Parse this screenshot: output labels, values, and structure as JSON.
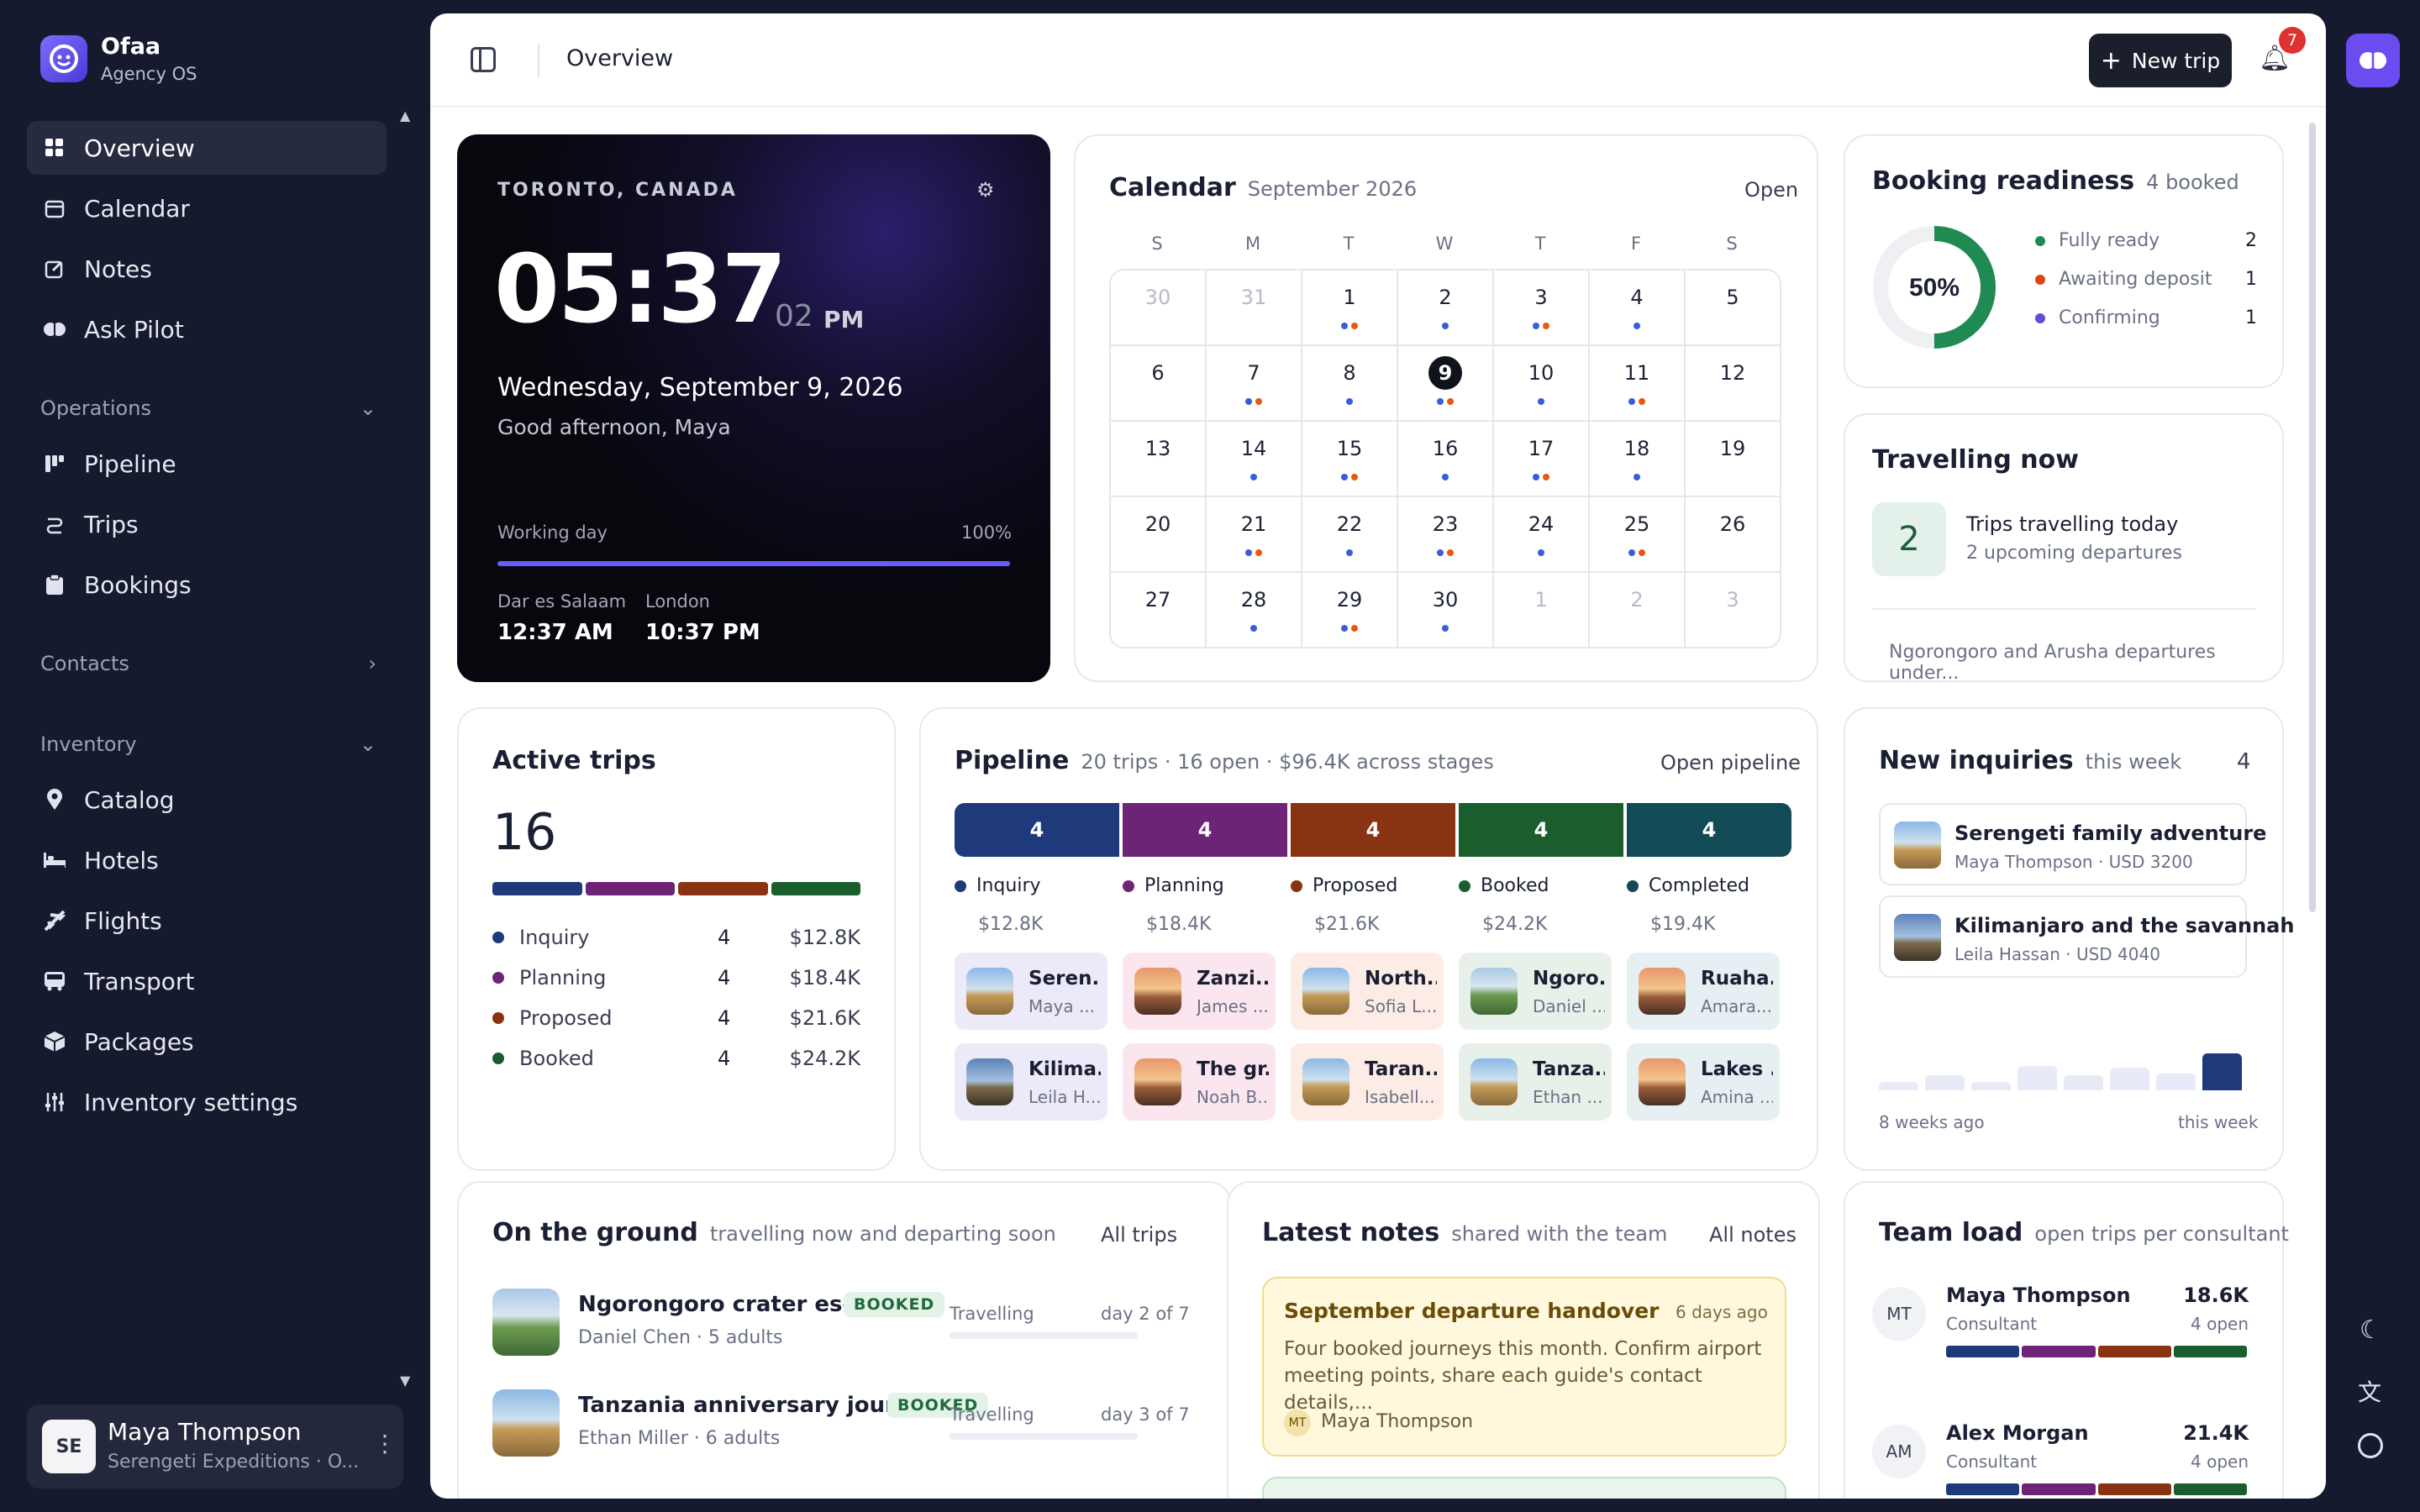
{
  "brand": {
    "name": "Ofaa",
    "subtitle": "Agency OS"
  },
  "nav": {
    "primary": [
      {
        "label": "Overview",
        "icon": "grid-icon",
        "active": true
      },
      {
        "label": "Calendar",
        "icon": "calendar-icon"
      },
      {
        "label": "Notes",
        "icon": "edit-icon"
      },
      {
        "label": "Ask Pilot",
        "icon": "brain-icon"
      }
    ],
    "operations": {
      "label": "Operations",
      "items": [
        {
          "label": "Pipeline",
          "icon": "kanban-icon"
        },
        {
          "label": "Trips",
          "icon": "route-icon"
        },
        {
          "label": "Bookings",
          "icon": "clipboard-icon"
        }
      ]
    },
    "contacts": {
      "label": "Contacts"
    },
    "inventory": {
      "label": "Inventory",
      "items": [
        {
          "label": "Catalog",
          "icon": "pin-icon"
        },
        {
          "label": "Hotels",
          "icon": "bed-icon"
        },
        {
          "label": "Flights",
          "icon": "plane-icon"
        },
        {
          "label": "Transport",
          "icon": "bus-icon"
        },
        {
          "label": "Packages",
          "icon": "package-icon"
        },
        {
          "label": "Inventory settings",
          "icon": "sliders-icon"
        }
      ]
    }
  },
  "user": {
    "initials": "SE",
    "name": "Maya Thompson",
    "org": "Serengeti Expeditions · O..."
  },
  "topbar": {
    "title": "Overview",
    "new_trip": "New trip",
    "notifications": "7"
  },
  "clock": {
    "location": "TORONTO, CANADA",
    "time": "05:37",
    "seconds": "02",
    "ampm": "PM",
    "date": "Wednesday, September 9, 2026",
    "greeting": "Good afternoon, Maya",
    "working_label": "Working day",
    "working_pct": "100%",
    "working_value": 1.0,
    "zones": [
      {
        "city": "Dar es Salaam",
        "time": "12:37 AM"
      },
      {
        "city": "London",
        "time": "10:37 PM"
      }
    ]
  },
  "calendar": {
    "title": "Calendar",
    "month": "September 2026",
    "open": "Open",
    "weekdays": [
      "S",
      "M",
      "T",
      "W",
      "T",
      "F",
      "S"
    ],
    "days": [
      {
        "d": "30",
        "dim": true
      },
      {
        "d": "31",
        "dim": true
      },
      {
        "d": "1",
        "dots": [
          "#3b5bdb",
          "#e8590c"
        ]
      },
      {
        "d": "2",
        "dots": [
          "#3b5bdb"
        ]
      },
      {
        "d": "3",
        "dots": [
          "#3b5bdb",
          "#e8590c"
        ]
      },
      {
        "d": "4",
        "dots": [
          "#3b5bdb"
        ]
      },
      {
        "d": "5"
      },
      {
        "d": "6"
      },
      {
        "d": "7",
        "dots": [
          "#3b5bdb",
          "#e8590c"
        ]
      },
      {
        "d": "8",
        "dots": [
          "#3b5bdb"
        ]
      },
      {
        "d": "9",
        "today": true,
        "dots": [
          "#3b5bdb",
          "#e8590c"
        ]
      },
      {
        "d": "10",
        "dots": [
          "#3b5bdb"
        ]
      },
      {
        "d": "11",
        "dots": [
          "#3b5bdb",
          "#e8590c"
        ]
      },
      {
        "d": "12"
      },
      {
        "d": "13"
      },
      {
        "d": "14",
        "dots": [
          "#3b5bdb"
        ]
      },
      {
        "d": "15",
        "dots": [
          "#3b5bdb",
          "#e8590c"
        ]
      },
      {
        "d": "16",
        "dots": [
          "#3b5bdb"
        ]
      },
      {
        "d": "17",
        "dots": [
          "#3b5bdb",
          "#e8590c"
        ]
      },
      {
        "d": "18",
        "dots": [
          "#3b5bdb"
        ]
      },
      {
        "d": "19"
      },
      {
        "d": "20"
      },
      {
        "d": "21",
        "dots": [
          "#3b5bdb",
          "#e8590c"
        ]
      },
      {
        "d": "22",
        "dots": [
          "#3b5bdb"
        ]
      },
      {
        "d": "23",
        "dots": [
          "#3b5bdb",
          "#e8590c"
        ]
      },
      {
        "d": "24",
        "dots": [
          "#3b5bdb"
        ]
      },
      {
        "d": "25",
        "dots": [
          "#3b5bdb",
          "#e8590c"
        ]
      },
      {
        "d": "26"
      },
      {
        "d": "27"
      },
      {
        "d": "28",
        "dots": [
          "#3b5bdb"
        ]
      },
      {
        "d": "29",
        "dots": [
          "#3b5bdb",
          "#e8590c"
        ]
      },
      {
        "d": "30",
        "dots": [
          "#3b5bdb"
        ]
      },
      {
        "d": "1",
        "dim": true
      },
      {
        "d": "2",
        "dim": true
      },
      {
        "d": "3",
        "dim": true
      }
    ]
  },
  "booking": {
    "title": "Booking readiness",
    "sub": "4 booked",
    "pct": "50%",
    "value": 0.5,
    "rows": [
      {
        "label": "Fully ready",
        "count": "2",
        "color": "#1f8a52"
      },
      {
        "label": "Awaiting deposit",
        "count": "1",
        "color": "#d9480f"
      },
      {
        "label": "Confirming",
        "count": "1",
        "color": "#5b4fd6"
      }
    ]
  },
  "travelling": {
    "title": "Travelling now",
    "count": "2",
    "line1": "Trips travelling today",
    "line2": "2 upcoming departures",
    "footer": "Ngorongoro and Arusha departures under..."
  },
  "active": {
    "title": "Active trips",
    "count": "16",
    "rows": [
      {
        "label": "Inquiry",
        "count": "4",
        "amount": "$12.8K",
        "color": "#1e3a7b"
      },
      {
        "label": "Planning",
        "count": "4",
        "amount": "$18.4K",
        "color": "#6d2477"
      },
      {
        "label": "Proposed",
        "count": "4",
        "amount": "$21.6K",
        "color": "#8a3312"
      },
      {
        "label": "Booked",
        "count": "4",
        "amount": "$24.2K",
        "color": "#1a5e2e"
      }
    ]
  },
  "pipeline": {
    "title": "Pipeline",
    "sub": "20 trips · 16 open · $96.4K across stages",
    "link": "Open pipeline",
    "stages": [
      {
        "label": "Inquiry",
        "count": "4",
        "amount": "$12.8K",
        "color": "#1e3a7b",
        "tint": "#eceaf9",
        "cards": [
          {
            "t": "Seren...",
            "s": "Maya ...",
            "th": "thumb-sky"
          },
          {
            "t": "Kilima...",
            "s": "Leila H...",
            "th": "thumb-blue"
          }
        ]
      },
      {
        "label": "Planning",
        "count": "4",
        "amount": "$18.4K",
        "color": "#6d2477",
        "tint": "#fbe6ef",
        "cards": [
          {
            "t": "Zanzi...",
            "s": "James ...",
            "th": "thumb-sunset"
          },
          {
            "t": "The gr...",
            "s": "Noah B...",
            "th": "thumb-sunset"
          }
        ]
      },
      {
        "label": "Proposed",
        "count": "4",
        "amount": "$21.6K",
        "color": "#8a3312",
        "tint": "#fcece5",
        "cards": [
          {
            "t": "North...",
            "s": "Sofia L...",
            "th": "thumb-sky"
          },
          {
            "t": "Taran...",
            "s": "Isabell...",
            "th": "thumb-sky"
          }
        ]
      },
      {
        "label": "Booked",
        "count": "4",
        "amount": "$24.2K",
        "color": "#1a5e2e",
        "tint": "#e7f1ea",
        "cards": [
          {
            "t": "Ngoro...",
            "s": "Daniel ...",
            "th": "thumb-green"
          },
          {
            "t": "Tanza...",
            "s": "Ethan ...",
            "th": "thumb-sky"
          }
        ]
      },
      {
        "label": "Completed",
        "count": "4",
        "amount": "$19.4K",
        "color": "#124a55",
        "tint": "#e6f0f2",
        "cards": [
          {
            "t": "Ruaha...",
            "s": "Amara...",
            "th": "thumb-sunset"
          },
          {
            "t": "Lakes ...",
            "s": "Amina ...",
            "th": "thumb-sunset"
          }
        ]
      }
    ]
  },
  "inquiries": {
    "title": "New inquiries",
    "sub": "this week",
    "count": "4",
    "items": [
      {
        "t": "Serengeti family adventure",
        "s": "Maya Thompson · USD 3200",
        "th": "thumb-sky"
      },
      {
        "t": "Kilimanjaro and the savannah",
        "s": "Leila Hassan · USD 4040",
        "th": "thumb-blue"
      }
    ],
    "bars": [
      0.2,
      0.4,
      0.22,
      0.65,
      0.42,
      0.62,
      0.45,
      1.0
    ],
    "from": "8 weeks ago",
    "to": "this week"
  },
  "ground": {
    "title": "On the ground",
    "sub": "travelling now and departing soon",
    "link": "All trips",
    "items": [
      {
        "t": "Ngorongoro crater escape",
        "s": "Daniel Chen · 5 adults",
        "badge": "BOOKED",
        "status": "Travelling",
        "day": "day 2 of 7",
        "th": "thumb-green"
      },
      {
        "t": "Tanzania anniversary journ...",
        "s": "Ethan Miller · 6 adults",
        "badge": "BOOKED",
        "status": "Travelling",
        "day": "day 3 of 7",
        "th": "thumb-sky"
      }
    ]
  },
  "notes": {
    "title": "Latest notes",
    "sub": "shared with the team",
    "link": "All notes",
    "note": {
      "title": "September departure handover",
      "age": "6 days ago",
      "body": "Four booked journeys this month. Confirm airport meeting points, share each guide's contact details,...",
      "author_initials": "MT",
      "author": "Maya Thompson"
    }
  },
  "team": {
    "title": "Team load",
    "sub": "open trips per consultant",
    "members": [
      {
        "initials": "MT",
        "name": "Maya Thompson",
        "role": "Consultant",
        "amount": "18.6K",
        "open": "4 open"
      },
      {
        "initials": "AM",
        "name": "Alex Morgan",
        "role": "Consultant",
        "amount": "21.4K",
        "open": "4 open"
      }
    ]
  }
}
